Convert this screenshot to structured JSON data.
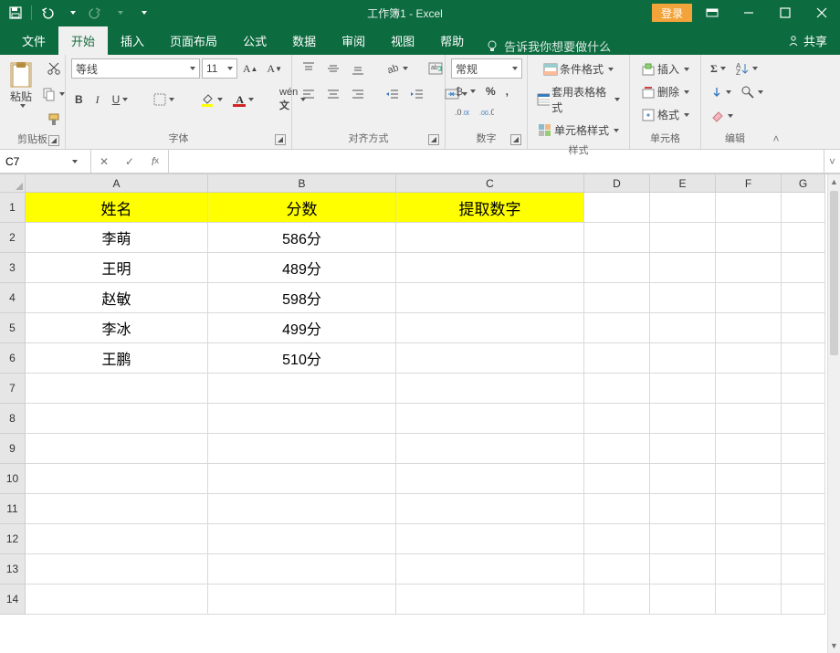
{
  "window": {
    "title": "工作簿1 - Excel",
    "login": "登录"
  },
  "tabs": {
    "file": "文件",
    "home": "开始",
    "insert": "插入",
    "layout": "页面布局",
    "formulas": "公式",
    "data": "数据",
    "review": "审阅",
    "view": "视图",
    "help": "帮助",
    "tellme": "告诉我你想要做什么",
    "share": "共享"
  },
  "ribbon": {
    "clipboard": {
      "label": "剪贴板",
      "paste": "粘贴"
    },
    "font": {
      "label": "字体",
      "name": "等线",
      "size": "11"
    },
    "alignment": {
      "label": "对齐方式"
    },
    "number": {
      "label": "数字",
      "format": "常规",
      "percent": "%"
    },
    "styles": {
      "label": "样式",
      "cond": "条件格式",
      "table": "套用表格格式",
      "cell": "单元格样式"
    },
    "cells": {
      "label": "单元格",
      "insert": "插入",
      "delete": "删除",
      "format": "格式"
    },
    "editing": {
      "label": "编辑"
    }
  },
  "formula_bar": {
    "name_box": "C7",
    "formula": ""
  },
  "columns": [
    "A",
    "B",
    "C",
    "D",
    "E",
    "F",
    "G"
  ],
  "rows": [
    1,
    2,
    3,
    4,
    5,
    6,
    7,
    8,
    9,
    10,
    11,
    12,
    13,
    14
  ],
  "headers": {
    "A": "姓名",
    "B": "分数",
    "C": "提取数字"
  },
  "data_rows": [
    {
      "A": "李萌",
      "B": "586分"
    },
    {
      "A": "王明",
      "B": "489分"
    },
    {
      "A": "赵敏",
      "B": "598分"
    },
    {
      "A": "李冰",
      "B": "499分"
    },
    {
      "A": "王鹏",
      "B": "510分"
    }
  ]
}
